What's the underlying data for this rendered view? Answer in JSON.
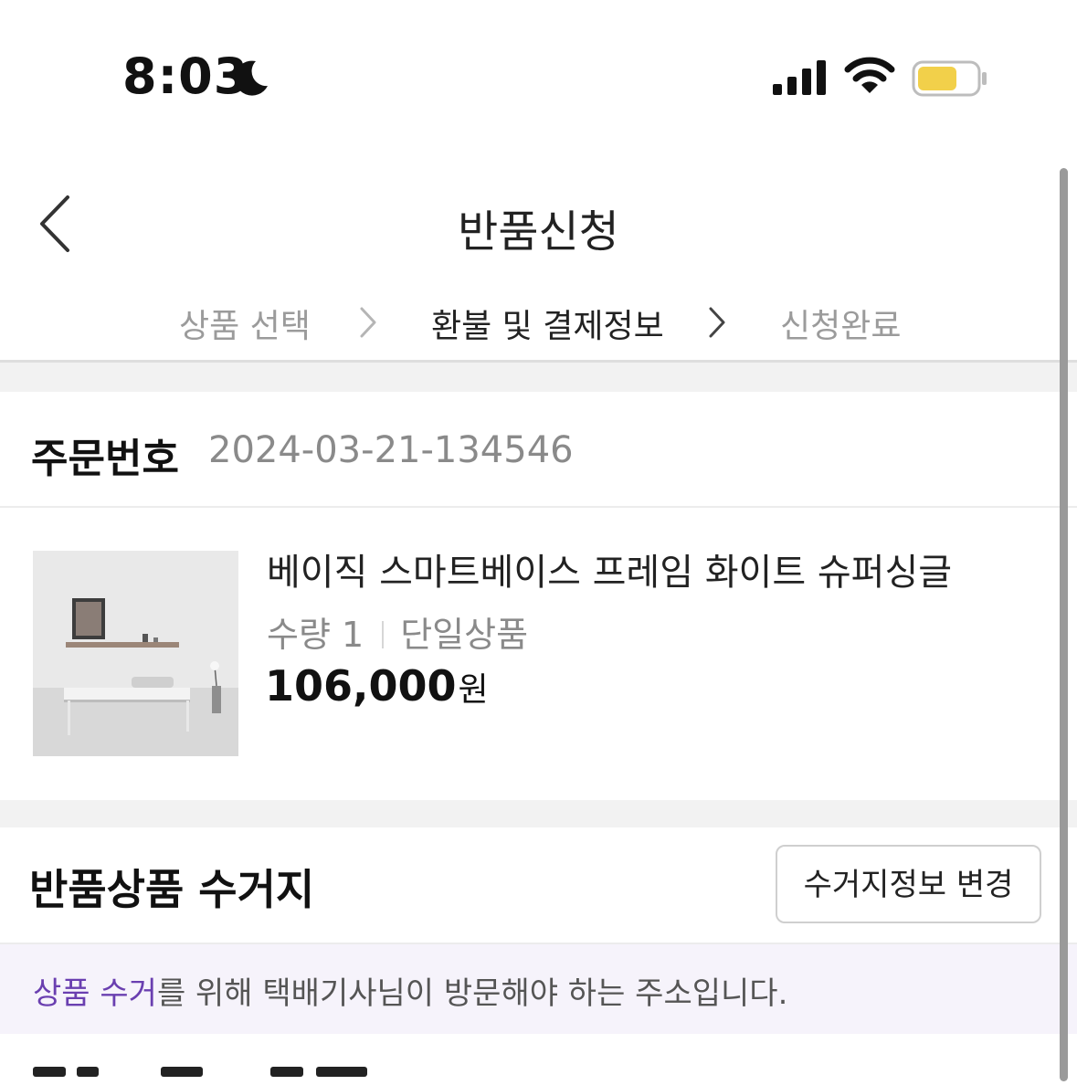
{
  "status_bar": {
    "time": "8:03",
    "focus_icon": "moon-icon",
    "signal_icon": "cellular-signal-icon",
    "wifi_icon": "wifi-icon",
    "battery_icon": "battery-icon",
    "battery_color": "#f2d04a"
  },
  "header": {
    "back_icon": "chevron-left-icon",
    "title": "반품신청"
  },
  "steps": {
    "items": [
      {
        "label": "상품 선택",
        "state": "inactive"
      },
      {
        "label": "환불 및 결제정보",
        "state": "active"
      },
      {
        "label": "신청완료",
        "state": "inactive"
      }
    ],
    "separator_icon": "chevron-right-icon"
  },
  "order": {
    "label": "주문번호",
    "number": "2024-03-21-134546"
  },
  "product": {
    "name": "베이직 스마트베이스 프레임 화이트 슈퍼싱글",
    "quantity": "수량 1",
    "option": "단일상품",
    "price": "106,000",
    "currency": "원"
  },
  "pickup": {
    "title": "반품상품 수거지",
    "change_button": "수거지정보 변경",
    "info_highlight": "상품 수거",
    "info_rest": "를 위해 택배기사님이 방문해야 하는 주소입니다."
  },
  "colors": {
    "accent_purple": "#6a3fb0",
    "banner_background": "#f6f3fb",
    "section_gap": "#f2f2f2"
  }
}
